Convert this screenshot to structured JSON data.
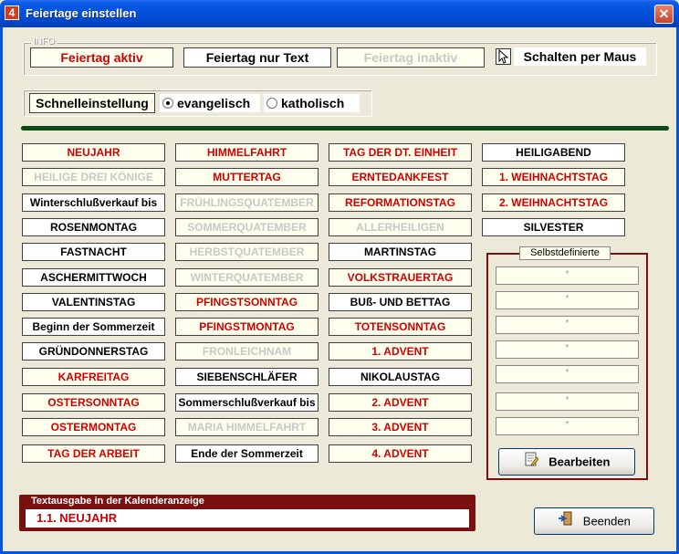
{
  "window": {
    "title": "Feiertage einstellen",
    "icon_glyph": "4",
    "close_glyph": "✕"
  },
  "info": {
    "legend": "INFO",
    "active": "Feiertag aktiv",
    "text_only": "Feiertag nur Text",
    "inactive": "Feiertag inaktiv",
    "mouse": "Schalten per Maus"
  },
  "quick": {
    "label": "Schnelleinstellung",
    "options": [
      {
        "label": "evangelisch",
        "selected": true
      },
      {
        "label": "katholisch",
        "selected": false
      }
    ]
  },
  "colors": {
    "active": "#D00000",
    "text_only": "#000000",
    "inactive": "#C8C8C8",
    "frame": "#7A0F0F"
  },
  "holidays": {
    "col1": [
      {
        "label": "NEUJAHR",
        "state": "red"
      },
      {
        "label": "HEILIGE DREI KÖNIGE",
        "state": "gray"
      },
      {
        "label": "Winterschlußverkauf bis",
        "state": "black"
      },
      {
        "label": "ROSENMONTAG",
        "state": "black"
      },
      {
        "label": "FASTNACHT",
        "state": "black"
      },
      {
        "label": "ASCHERMITTWOCH",
        "state": "black"
      },
      {
        "label": "VALENTINSTAG",
        "state": "black"
      },
      {
        "label": "Beginn der Sommerzeit",
        "state": "black"
      },
      {
        "label": "GRÜNDONNERSTAG",
        "state": "black"
      },
      {
        "label": "KARFREITAG",
        "state": "red"
      },
      {
        "label": "OSTERSONNTAG",
        "state": "red"
      },
      {
        "label": "OSTERMONTAG",
        "state": "red"
      },
      {
        "label": "TAG DER ARBEIT",
        "state": "red"
      }
    ],
    "col2": [
      {
        "label": "HIMMELFAHRT",
        "state": "red"
      },
      {
        "label": "MUTTERTAG",
        "state": "red"
      },
      {
        "label": "FRÜHLINGSQUATEMBER",
        "state": "gray"
      },
      {
        "label": "SOMMERQUATEMBER",
        "state": "gray"
      },
      {
        "label": "HERBSTQUATEMBER",
        "state": "gray"
      },
      {
        "label": "WINTERQUATEMBER",
        "state": "gray"
      },
      {
        "label": "PFINGSTSONNTAG",
        "state": "red"
      },
      {
        "label": "PFINGSTMONTAG",
        "state": "red"
      },
      {
        "label": "FRONLEICHNAM",
        "state": "gray"
      },
      {
        "label": "SIEBENSCHLÄFER",
        "state": "black"
      },
      {
        "label": "Sommerschlußverkauf bis",
        "state": "black"
      },
      {
        "label": "MARIA HIMMELFAHRT",
        "state": "gray"
      },
      {
        "label": "Ende der Sommerzeit",
        "state": "black"
      }
    ],
    "col3": [
      {
        "label": "TAG DER DT. EINHEIT",
        "state": "red"
      },
      {
        "label": "ERNTEDANKFEST",
        "state": "red"
      },
      {
        "label": "REFORMATIONSTAG",
        "state": "red"
      },
      {
        "label": "ALLERHEILIGEN",
        "state": "gray"
      },
      {
        "label": "MARTINSTAG",
        "state": "black"
      },
      {
        "label": "VOLKSTRAUERTAG",
        "state": "red"
      },
      {
        "label": "BUß- UND BETTAG",
        "state": "black"
      },
      {
        "label": "TOTENSONNTAG",
        "state": "red"
      },
      {
        "label": "1. ADVENT",
        "state": "red"
      },
      {
        "label": "NIKOLAUSTAG",
        "state": "black"
      },
      {
        "label": "2. ADVENT",
        "state": "red"
      },
      {
        "label": "3. ADVENT",
        "state": "red"
      },
      {
        "label": "4. ADVENT",
        "state": "red"
      }
    ],
    "col4": [
      {
        "label": "HEILIGABEND",
        "state": "black"
      },
      {
        "label": "1. WEIHNACHTSTAG",
        "state": "red"
      },
      {
        "label": "2. WEIHNACHTSTAG",
        "state": "red"
      },
      {
        "label": "SILVESTER",
        "state": "black"
      }
    ]
  },
  "custom": {
    "label": "Selbstdefinierte",
    "items": [
      "*",
      "*",
      "*",
      "*",
      "*",
      "*",
      "*"
    ],
    "edit_button": "Bearbeiten"
  },
  "output": {
    "legend": "Textausgabe in der Kalenderanzeige",
    "value": "1.1.  NEUJAHR"
  },
  "footer": {
    "exit_button": "Beenden"
  }
}
